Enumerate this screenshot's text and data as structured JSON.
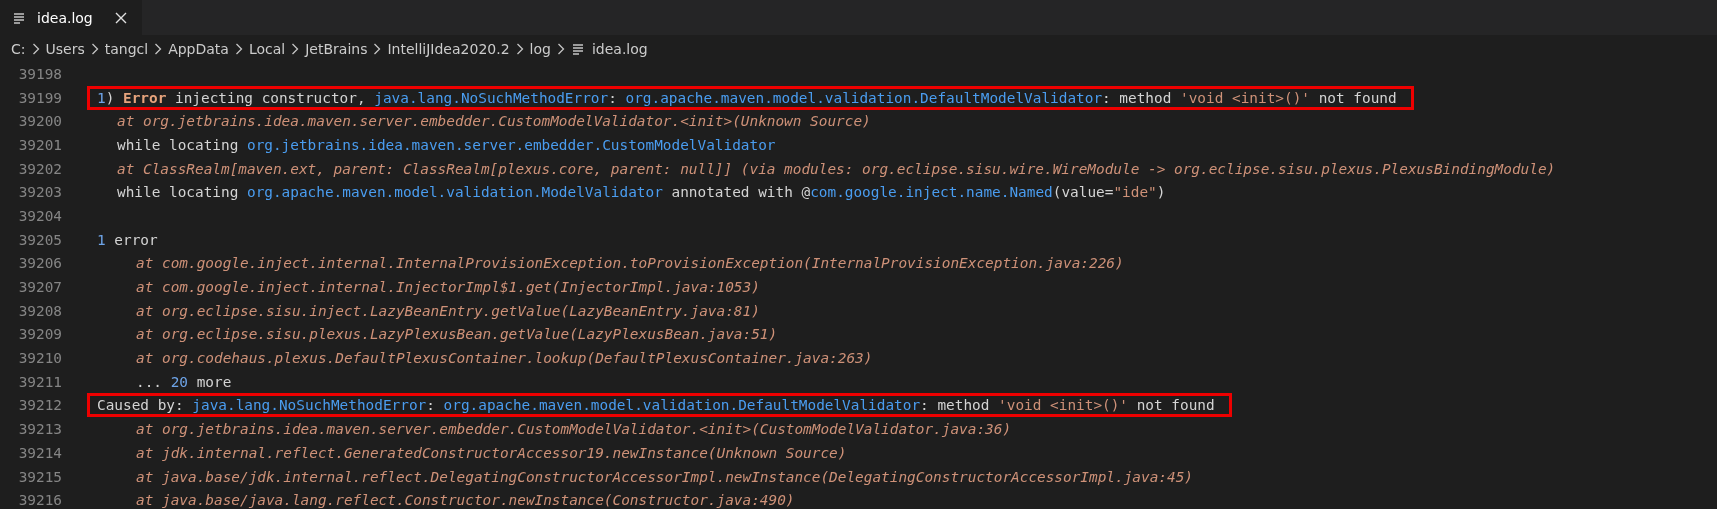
{
  "tabs": [
    {
      "label": "idea.log",
      "selected": true
    }
  ],
  "breadcrumb": [
    {
      "label": "C:",
      "kind": "folder"
    },
    {
      "label": "Users",
      "kind": "folder"
    },
    {
      "label": "tangcl",
      "kind": "folder"
    },
    {
      "label": "AppData",
      "kind": "folder"
    },
    {
      "label": "Local",
      "kind": "folder"
    },
    {
      "label": "JetBrains",
      "kind": "folder"
    },
    {
      "label": "IntelliJIdea2020.2",
      "kind": "folder"
    },
    {
      "label": "log",
      "kind": "folder"
    },
    {
      "label": "idea.log",
      "kind": "file"
    }
  ],
  "lines": [
    {
      "number": "39198",
      "kind": "top",
      "highlighted": false
    },
    {
      "number": "39199",
      "kind": "top",
      "highlighted": true,
      "segments": [
        {
          "kind": "number",
          "text": "1"
        },
        {
          "kind": "plain",
          "text": ") "
        },
        {
          "kind": "keyword",
          "text": "Error"
        },
        {
          "kind": "plain",
          "text": " injecting constructor, "
        },
        {
          "kind": "class",
          "text": "java.lang.NoSuchMethodError"
        },
        {
          "kind": "plain",
          "text": ": "
        },
        {
          "kind": "class",
          "text": "org.apache.maven.model.validation.DefaultModelValidator"
        },
        {
          "kind": "plain",
          "text": ": method "
        },
        {
          "kind": "string",
          "text": "'void <init>()'"
        },
        {
          "kind": "plain",
          "text": " not found"
        }
      ]
    },
    {
      "number": "39200",
      "kind": "detail",
      "highlighted": false,
      "segments": [
        {
          "kind": "stack",
          "text": "at org.jetbrains.idea.maven.server.embedder.CustomModelValidator.<init>(Unknown Source)"
        }
      ]
    },
    {
      "number": "39201",
      "kind": "detail",
      "highlighted": false,
      "segments": [
        {
          "kind": "plain",
          "text": "while locating "
        },
        {
          "kind": "class",
          "text": "org.jetbrains.idea.maven.server.embedder.CustomModelValidator"
        }
      ]
    },
    {
      "number": "39202",
      "kind": "detail",
      "highlighted": false,
      "segments": [
        {
          "kind": "stack",
          "text": "at ClassRealm[maven.ext, parent: ClassRealm[plexus.core, parent: null]] (via modules: org.eclipse.sisu.wire.WireModule -> org.eclipse.sisu.plexus.PlexusBindingModule)"
        }
      ]
    },
    {
      "number": "39203",
      "kind": "detail",
      "highlighted": false,
      "segments": [
        {
          "kind": "plain",
          "text": "while locating "
        },
        {
          "kind": "class",
          "text": "org.apache.maven.model.validation.ModelValidator"
        },
        {
          "kind": "plain",
          "text": " annotated with @"
        },
        {
          "kind": "class",
          "text": "com.google.inject.name.Named"
        },
        {
          "kind": "plain",
          "text": "(value="
        },
        {
          "kind": "string",
          "text": "\"ide\""
        },
        {
          "kind": "plain",
          "text": ")"
        }
      ]
    },
    {
      "number": "39204",
      "kind": "top",
      "highlighted": false
    },
    {
      "number": "39205",
      "kind": "top",
      "highlighted": false,
      "segments": [
        {
          "kind": "number",
          "text": "1"
        },
        {
          "kind": "plain",
          "text": " error"
        }
      ]
    },
    {
      "number": "39206",
      "kind": "trace",
      "highlighted": false,
      "segments": [
        {
          "kind": "stack",
          "text": "at com.google.inject.internal.InternalProvisionException.toProvisionException(InternalProvisionException.java:226)"
        }
      ]
    },
    {
      "number": "39207",
      "kind": "trace",
      "highlighted": false,
      "segments": [
        {
          "kind": "stack",
          "text": "at com.google.inject.internal.InjectorImpl$1.get(InjectorImpl.java:1053)"
        }
      ]
    },
    {
      "number": "39208",
      "kind": "trace",
      "highlighted": false,
      "segments": [
        {
          "kind": "stack",
          "text": "at org.eclipse.sisu.inject.LazyBeanEntry.getValue(LazyBeanEntry.java:81)"
        }
      ]
    },
    {
      "number": "39209",
      "kind": "trace",
      "highlighted": false,
      "segments": [
        {
          "kind": "stack",
          "text": "at org.eclipse.sisu.plexus.LazyPlexusBean.getValue(LazyPlexusBean.java:51)"
        }
      ]
    },
    {
      "number": "39210",
      "kind": "trace",
      "highlighted": false,
      "segments": [
        {
          "kind": "stack",
          "text": "at org.codehaus.plexus.DefaultPlexusContainer.lookup(DefaultPlexusContainer.java:263)"
        }
      ]
    },
    {
      "number": "39211",
      "kind": "trace",
      "highlighted": false,
      "segments": [
        {
          "kind": "plain",
          "text": "... "
        },
        {
          "kind": "number",
          "text": "20"
        },
        {
          "kind": "plain",
          "text": " more"
        }
      ]
    },
    {
      "number": "39212",
      "kind": "top",
      "highlighted": true,
      "segments": [
        {
          "kind": "plain",
          "text": "Caused by: "
        },
        {
          "kind": "class",
          "text": "java.lang.NoSuchMethodError"
        },
        {
          "kind": "plain",
          "text": ": "
        },
        {
          "kind": "class",
          "text": "org.apache.maven.model.validation.DefaultModelValidator"
        },
        {
          "kind": "plain",
          "text": ": method "
        },
        {
          "kind": "string",
          "text": "'void <init>()'"
        },
        {
          "kind": "plain",
          "text": " not found"
        }
      ]
    },
    {
      "number": "39213",
      "kind": "trace",
      "highlighted": false,
      "segments": [
        {
          "kind": "stack",
          "text": "at org.jetbrains.idea.maven.server.embedder.CustomModelValidator.<init>(CustomModelValidator.java:36)"
        }
      ]
    },
    {
      "number": "39214",
      "kind": "trace",
      "highlighted": false,
      "segments": [
        {
          "kind": "stack",
          "text": "at jdk.internal.reflect.GeneratedConstructorAccessor19.newInstance(Unknown Source)"
        }
      ]
    },
    {
      "number": "39215",
      "kind": "trace",
      "highlighted": false,
      "segments": [
        {
          "kind": "stack",
          "text": "at java.base/jdk.internal.reflect.DelegatingConstructorAccessorImpl.newInstance(DelegatingConstructorAccessorImpl.java:45)"
        }
      ]
    },
    {
      "number": "39216",
      "kind": "trace",
      "highlighted": false,
      "segments": [
        {
          "kind": "stack",
          "text": "at java.base/java.lang.reflect.Constructor.newInstance(Constructor.java:490)"
        }
      ]
    }
  ]
}
